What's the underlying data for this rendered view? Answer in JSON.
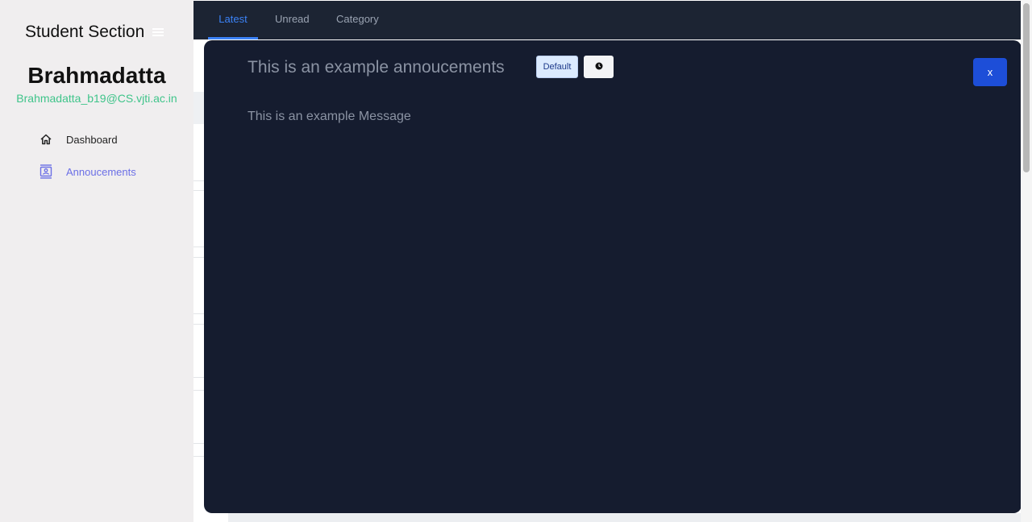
{
  "sidebar": {
    "brand": "Student Section",
    "user_name": "Brahmadatta",
    "user_email": "Brahmadatta_b19@CS.vjti.ac.in",
    "items": [
      {
        "label": "Dashboard",
        "icon": "home-icon"
      },
      {
        "label": "Annoucements",
        "icon": "announcement-icon"
      }
    ]
  },
  "tabs": [
    {
      "label": "Latest"
    },
    {
      "label": "Unread"
    },
    {
      "label": "Category"
    }
  ],
  "modal": {
    "title": "This is an example annoucements",
    "badge": "Default",
    "message": "This is an example Message",
    "close_label": "x"
  },
  "colors": {
    "accent": "#3b82f6",
    "modal_bg": "#151c2f",
    "email": "#3fc48a",
    "active_nav": "#6b6fe6",
    "close_button": "#1d4ed8"
  }
}
